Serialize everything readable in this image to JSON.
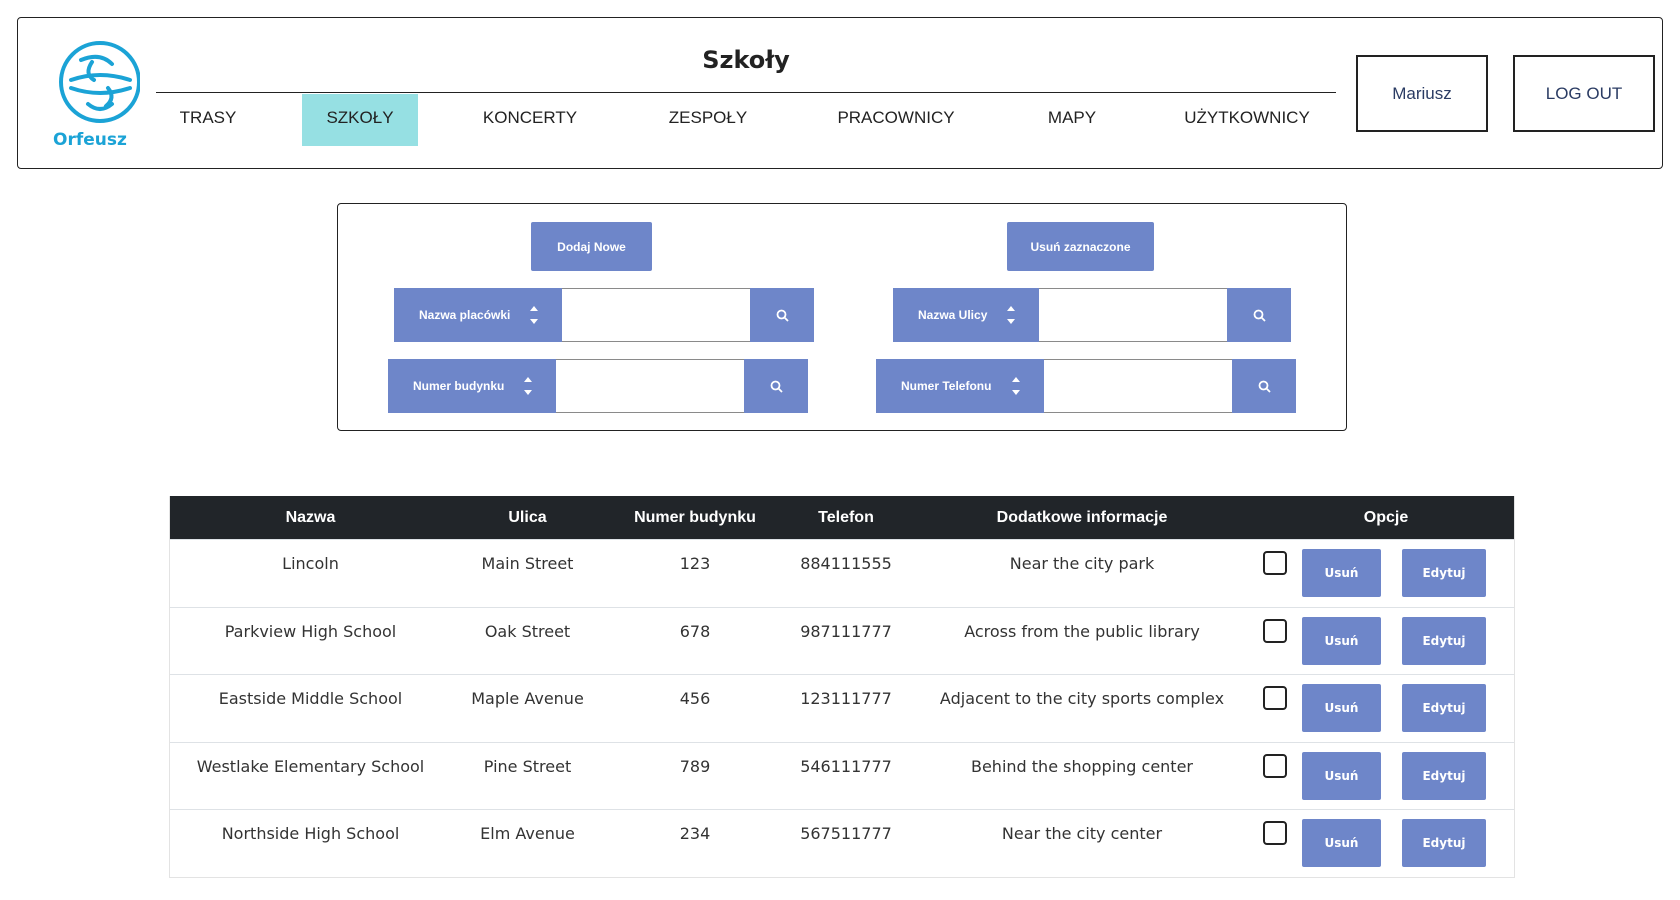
{
  "app": {
    "logo_text": "Orfeusz",
    "title": "Szkoły",
    "accent": "#6e86c9",
    "active_tab_color": "#96e0e3"
  },
  "nav": [
    {
      "label": "TRASY"
    },
    {
      "label": "SZKOŁY",
      "active": true
    },
    {
      "label": "KONCERTY"
    },
    {
      "label": "ZESPOŁY"
    },
    {
      "label": "PRACOWNICY"
    },
    {
      "label": "MAPY"
    },
    {
      "label": "UŻYTKOWNICY"
    }
  ],
  "user": {
    "name": "Mariusz",
    "logout_label": "LOG OUT"
  },
  "actions": {
    "add_label": "Dodaj Nowe",
    "delete_selected_label": "Usuń zaznaczone"
  },
  "filters": {
    "name": {
      "label": "Nazwa placówki",
      "value": ""
    },
    "street": {
      "label": "Nazwa Ulicy",
      "value": ""
    },
    "building": {
      "label": "Numer budynku",
      "value": ""
    },
    "phone": {
      "label": "Numer Telefonu",
      "value": ""
    }
  },
  "table": {
    "headers": [
      "Nazwa",
      "Ulica",
      "Numer budynku",
      "Telefon",
      "Dodatkowe informacje",
      "Opcje"
    ],
    "delete_label": "Usuń",
    "edit_label": "Edytuj",
    "rows": [
      [
        "Lincoln",
        "Main Street",
        "123",
        "884111555",
        "Near the city park"
      ],
      [
        "Parkview High School",
        "Oak Street",
        "678",
        "987111777",
        "Across from the public library"
      ],
      [
        "Eastside Middle School",
        "Maple Avenue",
        "456",
        "123111777",
        "Adjacent to the city sports complex"
      ],
      [
        "Westlake Elementary School",
        "Pine Street",
        "789",
        "546111777",
        "Behind the shopping center"
      ],
      [
        "Northside High School",
        "Elm Avenue",
        "234",
        "567511777",
        "Near the city center"
      ]
    ]
  }
}
